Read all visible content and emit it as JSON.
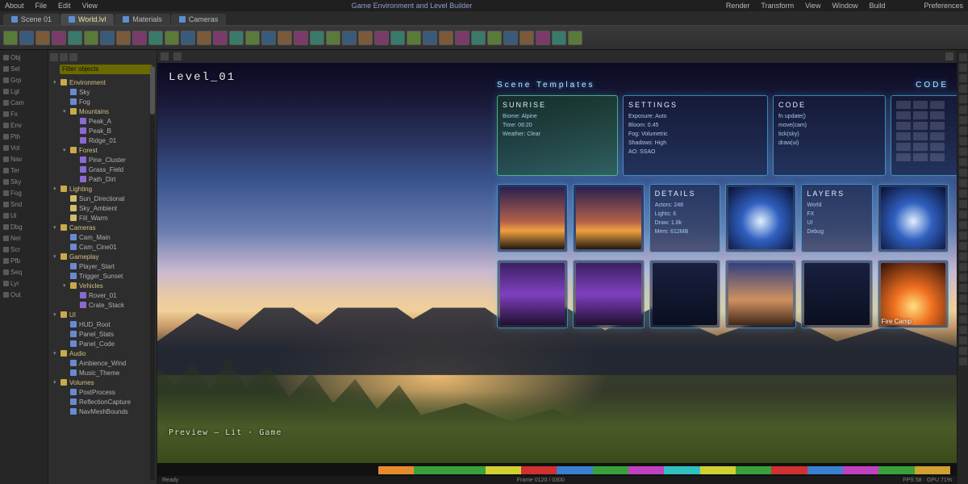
{
  "menubar": {
    "items": [
      "About",
      "File",
      "Edit",
      "View"
    ],
    "center": "Game Environment and Level Builder",
    "right_items": [
      "Render",
      "Transform",
      "View",
      "Window",
      "Build"
    ],
    "far_right": "Preferences"
  },
  "doc_tabs": [
    {
      "label": "Scene 01",
      "active": false
    },
    {
      "label": "World.lvl",
      "active": true
    },
    {
      "label": "Materials",
      "active": false
    },
    {
      "label": "Cameras",
      "active": false
    }
  ],
  "toolbar_count": 36,
  "far_left": {
    "rows": [
      "Obj",
      "Sel",
      "Grp",
      "Lgt",
      "Cam",
      "Fx",
      "Env",
      "Pth",
      "Vol",
      "Nav",
      "Ter",
      "Sky",
      "Fog",
      "Snd",
      "Ui",
      "Dbg",
      "Net",
      "Scr",
      "Pfb",
      "Seq",
      "Lyr",
      "Out"
    ]
  },
  "hierarchy": {
    "search_placeholder": "Filter objects",
    "items": [
      {
        "d": 0,
        "icon": "folder",
        "label": "Environment",
        "group": true
      },
      {
        "d": 12,
        "icon": "cube",
        "label": "Sky"
      },
      {
        "d": 12,
        "icon": "cube",
        "label": "Fog"
      },
      {
        "d": 12,
        "icon": "folder",
        "label": "Mountains",
        "group": true
      },
      {
        "d": 24,
        "icon": "mesh",
        "label": "Peak_A"
      },
      {
        "d": 24,
        "icon": "mesh",
        "label": "Peak_B"
      },
      {
        "d": 24,
        "icon": "mesh",
        "label": "Ridge_01"
      },
      {
        "d": 12,
        "icon": "folder",
        "label": "Forest",
        "group": true
      },
      {
        "d": 24,
        "icon": "mesh",
        "label": "Pine_Cluster"
      },
      {
        "d": 24,
        "icon": "mesh",
        "label": "Grass_Field"
      },
      {
        "d": 24,
        "icon": "mesh",
        "label": "Path_Dirt"
      },
      {
        "d": 0,
        "icon": "folder",
        "label": "Lighting",
        "group": true
      },
      {
        "d": 12,
        "icon": "light",
        "label": "Sun_Directional"
      },
      {
        "d": 12,
        "icon": "light",
        "label": "Sky_Ambient"
      },
      {
        "d": 12,
        "icon": "light",
        "label": "Fill_Warm"
      },
      {
        "d": 0,
        "icon": "folder",
        "label": "Cameras",
        "group": true
      },
      {
        "d": 12,
        "icon": "cube",
        "label": "Cam_Main"
      },
      {
        "d": 12,
        "icon": "cube",
        "label": "Cam_Cine01"
      },
      {
        "d": 0,
        "icon": "folder",
        "label": "Gameplay",
        "group": true
      },
      {
        "d": 12,
        "icon": "cube",
        "label": "Player_Start"
      },
      {
        "d": 12,
        "icon": "cube",
        "label": "Trigger_Sunset"
      },
      {
        "d": 12,
        "icon": "folder",
        "label": "Vehicles",
        "group": true
      },
      {
        "d": 24,
        "icon": "mesh",
        "label": "Rover_01"
      },
      {
        "d": 24,
        "icon": "mesh",
        "label": "Crate_Stack"
      },
      {
        "d": 0,
        "icon": "folder",
        "label": "UI",
        "group": true
      },
      {
        "d": 12,
        "icon": "cube",
        "label": "HUD_Root"
      },
      {
        "d": 12,
        "icon": "cube",
        "label": "Panel_Stats"
      },
      {
        "d": 12,
        "icon": "cube",
        "label": "Panel_Code"
      },
      {
        "d": 0,
        "icon": "folder",
        "label": "Audio",
        "group": true
      },
      {
        "d": 12,
        "icon": "cube",
        "label": "Ambience_Wind"
      },
      {
        "d": 12,
        "icon": "cube",
        "label": "Music_Theme"
      },
      {
        "d": 0,
        "icon": "folder",
        "label": "Volumes",
        "group": true
      },
      {
        "d": 12,
        "icon": "cube",
        "label": "PostProcess"
      },
      {
        "d": 12,
        "icon": "cube",
        "label": "ReflectionCapture"
      },
      {
        "d": 12,
        "icon": "cube",
        "label": "NavMeshBounds"
      }
    ]
  },
  "viewport": {
    "title": "Level_01",
    "caption": "Preview — Lit · Game",
    "hud_header_left": "Scene Templates",
    "hud_header_right": "CODE",
    "cards_row1": [
      {
        "kind": "green",
        "title": "Sunrise",
        "lines": [
          "Biome: Alpine",
          "Time: 06:20",
          "Weather: Clear"
        ]
      },
      {
        "kind": "panel",
        "title": "Settings",
        "lines": [
          "Exposure: Auto",
          "Bloom: 0.45",
          "Fog: Volumetric",
          "Shadows: High",
          "AO: SSAO"
        ]
      },
      {
        "kind": "panel",
        "title": "Code",
        "lines": [
          "fn update()",
          "  move(cam)",
          "  tick(sky)",
          "  draw(ui)"
        ]
      },
      {
        "kind": "mini",
        "title": "",
        "lines": []
      }
    ],
    "cards_row2": [
      {
        "kind": "img",
        "thumb": "th-sunset",
        "title": ""
      },
      {
        "kind": "img",
        "thumb": "th-sunset",
        "title": ""
      },
      {
        "kind": "panel",
        "thumb": "",
        "title": "Details",
        "lines": [
          "Actors: 248",
          "Lights: 6",
          "Draw: 1.8k",
          "Mem: 612MB"
        ]
      },
      {
        "kind": "img",
        "thumb": "th-blue",
        "title": ""
      },
      {
        "kind": "panel",
        "thumb": "",
        "title": "Layers",
        "lines": [
          "World",
          "FX",
          "UI",
          "Debug"
        ]
      },
      {
        "kind": "img",
        "thumb": "th-blue",
        "title": ""
      }
    ],
    "cards_row3": [
      {
        "kind": "img",
        "thumb": "th-purple",
        "title": ""
      },
      {
        "kind": "img",
        "thumb": "th-purple",
        "title": ""
      },
      {
        "kind": "img",
        "thumb": "th-dark",
        "title": ""
      },
      {
        "kind": "img",
        "thumb": "th-dawn",
        "title": ""
      },
      {
        "kind": "img",
        "thumb": "th-dark",
        "title": ""
      },
      {
        "kind": "img",
        "thumb": "th-fire",
        "title": "Fire Camp"
      }
    ]
  },
  "timeline_colors": [
    "#e68a2e",
    "#3aa03a",
    "#3aa03a",
    "#d0d030",
    "#d03030",
    "#3a80d0",
    "#3aa03a",
    "#c040c0",
    "#30c0c0",
    "#d0d030",
    "#3aa03a",
    "#d03030",
    "#3a80d0",
    "#c040c0",
    "#3aa03a",
    "#d0a030"
  ],
  "statusbar": {
    "left": "Ready",
    "mid": "Frame 0120 / 0300",
    "right": "FPS 58 · GPU 71%"
  }
}
